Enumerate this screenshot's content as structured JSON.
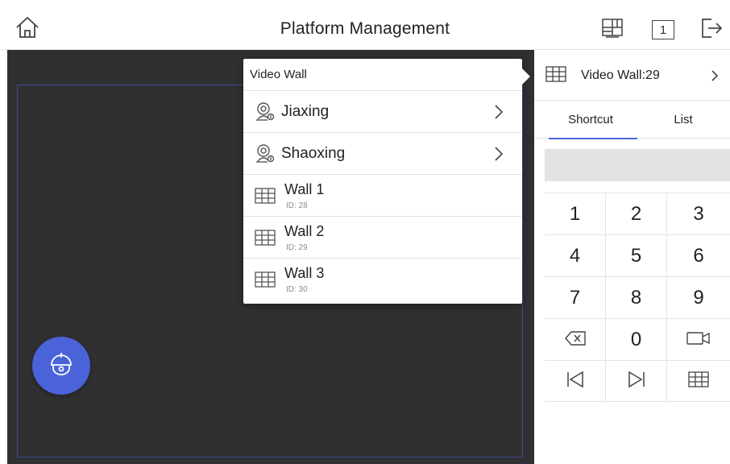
{
  "header": {
    "title": "Platform Management",
    "layout_button_value": "1",
    "icons": [
      "home-icon",
      "wall-layout-icon",
      "screen-number-icon",
      "logout-icon"
    ]
  },
  "popup": {
    "title": "Video Wall",
    "groups": [
      {
        "label": "Jiaxing",
        "icon": "region-icon"
      },
      {
        "label": "Shaoxing",
        "icon": "region-icon"
      }
    ],
    "walls": [
      {
        "name": "Wall 1",
        "id": "ID: 28"
      },
      {
        "name": "Wall 2",
        "id": "ID: 29"
      },
      {
        "name": "Wall 3",
        "id": "ID: 30"
      }
    ]
  },
  "panel": {
    "video_wall_label": "Video Wall:29",
    "tabs": [
      "Shortcut",
      "List"
    ],
    "active_tab": "Shortcut",
    "display_value": "",
    "keys": [
      [
        "1",
        "2",
        "3"
      ],
      [
        "4",
        "5",
        "6"
      ],
      [
        "7",
        "8",
        "9"
      ],
      [
        "backspace-icon",
        "0",
        "camera-icon"
      ],
      [
        "previous-icon",
        "next-icon",
        "wall-grid-icon"
      ]
    ]
  },
  "colors": {
    "accent": "#4a63d9",
    "canvas_bg": "#303033",
    "frame_border": "#3d4b8a"
  }
}
